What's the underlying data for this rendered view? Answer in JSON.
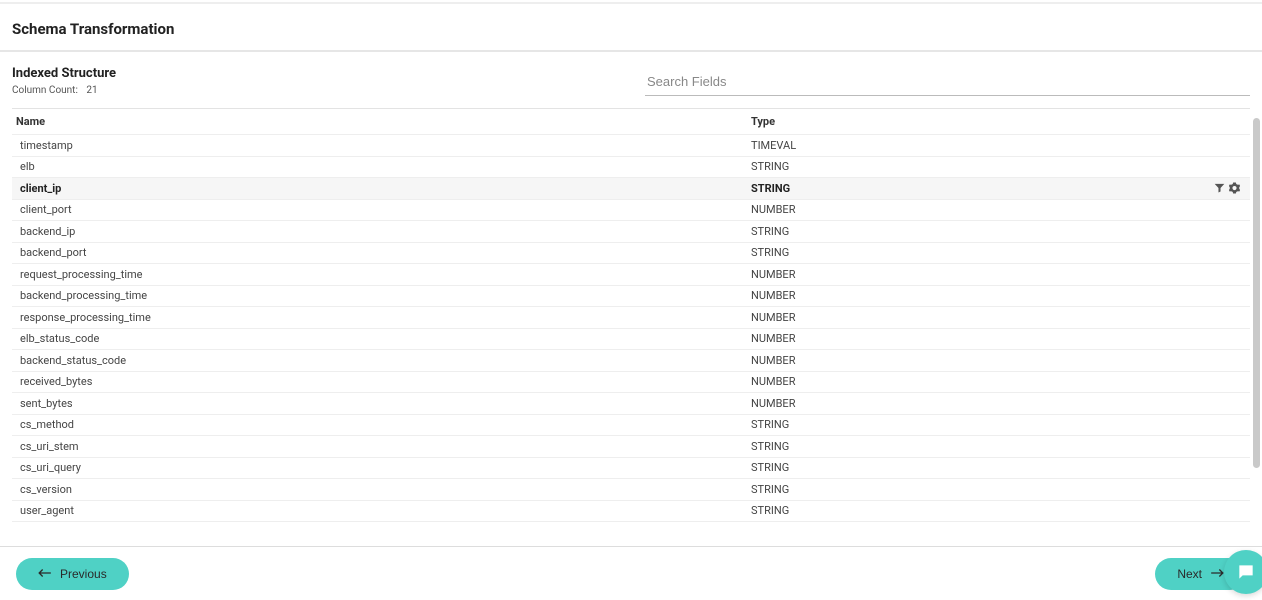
{
  "page": {
    "title": "Schema Transformation",
    "subtitle": "Indexed Structure",
    "column_count_label": "Column Count:",
    "column_count_value": "21"
  },
  "search": {
    "placeholder": "Search Fields"
  },
  "table": {
    "headers": {
      "name": "Name",
      "type": "Type"
    },
    "rows": [
      {
        "name": "timestamp",
        "type": "TIMEVAL",
        "selected": false
      },
      {
        "name": "elb",
        "type": "STRING",
        "selected": false
      },
      {
        "name": "client_ip",
        "type": "STRING",
        "selected": true
      },
      {
        "name": "client_port",
        "type": "NUMBER",
        "selected": false
      },
      {
        "name": "backend_ip",
        "type": "STRING",
        "selected": false
      },
      {
        "name": "backend_port",
        "type": "STRING",
        "selected": false
      },
      {
        "name": "request_processing_time",
        "type": "NUMBER",
        "selected": false
      },
      {
        "name": "backend_processing_time",
        "type": "NUMBER",
        "selected": false
      },
      {
        "name": "response_processing_time",
        "type": "NUMBER",
        "selected": false
      },
      {
        "name": "elb_status_code",
        "type": "NUMBER",
        "selected": false
      },
      {
        "name": "backend_status_code",
        "type": "NUMBER",
        "selected": false
      },
      {
        "name": "received_bytes",
        "type": "NUMBER",
        "selected": false
      },
      {
        "name": "sent_bytes",
        "type": "NUMBER",
        "selected": false
      },
      {
        "name": "cs_method",
        "type": "STRING",
        "selected": false
      },
      {
        "name": "cs_uri_stem",
        "type": "STRING",
        "selected": false
      },
      {
        "name": "cs_uri_query",
        "type": "STRING",
        "selected": false
      },
      {
        "name": "cs_version",
        "type": "STRING",
        "selected": false
      },
      {
        "name": "user_agent",
        "type": "STRING",
        "selected": false
      }
    ]
  },
  "footer": {
    "previous": "Previous",
    "next": "Next"
  }
}
